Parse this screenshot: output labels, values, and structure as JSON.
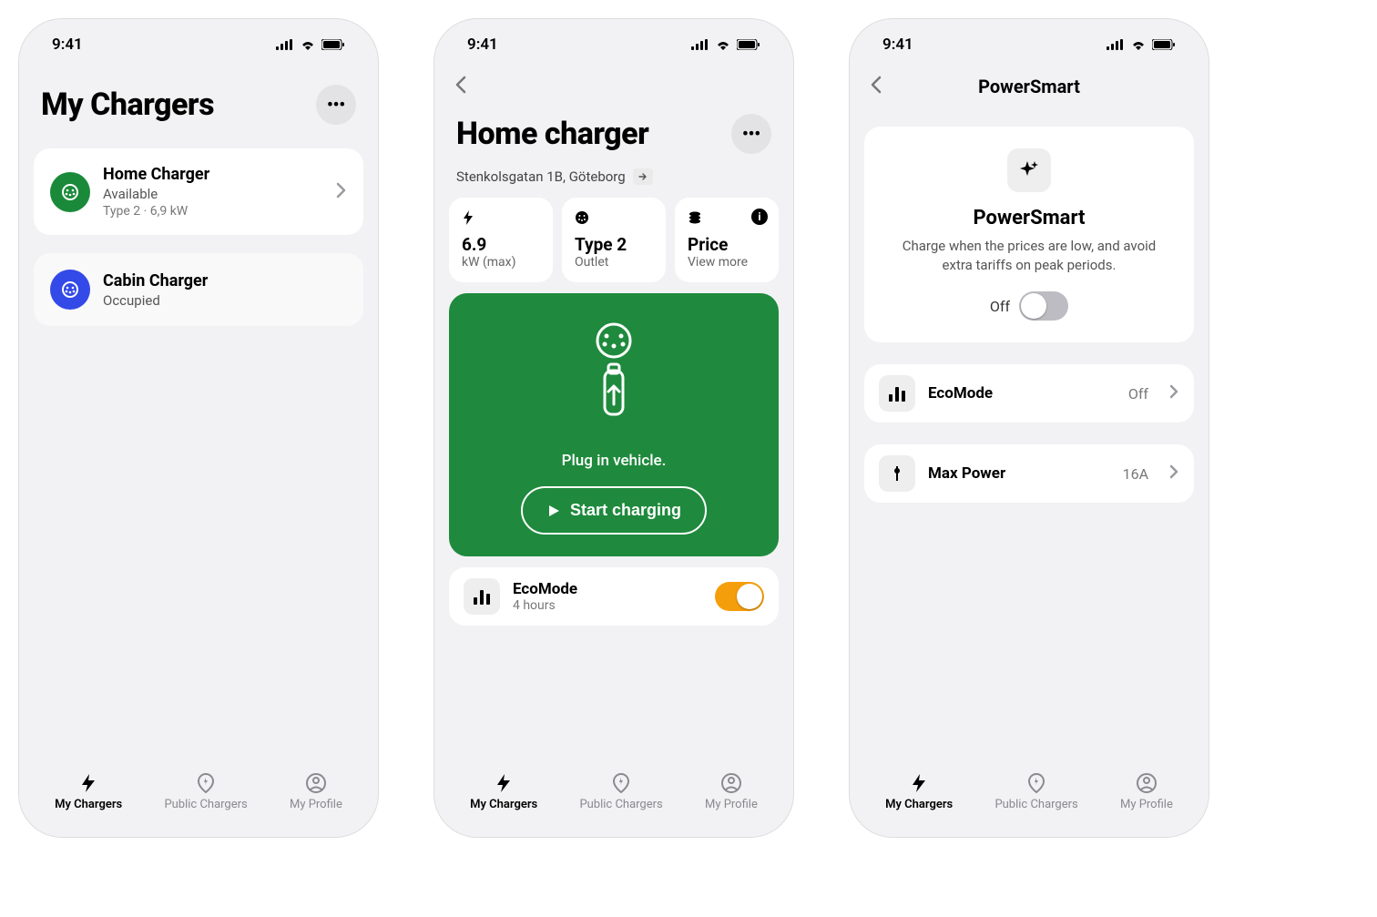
{
  "status": {
    "time": "9:41"
  },
  "tabs": {
    "my_chargers": "My Chargers",
    "public_chargers": "Public Chargers",
    "my_profile": "My Profile"
  },
  "screen1": {
    "title": "My Chargers",
    "chargers": [
      {
        "title": "Home Charger",
        "status": "Available",
        "connector": "Type 2",
        "power": "6,9 kW"
      },
      {
        "title": "Cabin Charger",
        "status": "Occupied"
      }
    ]
  },
  "screen2": {
    "title": "Home charger",
    "address": "Stenkolsgatan 1B, Göteborg",
    "stats": {
      "power_value": "6.9",
      "power_label": "kW (max)",
      "outlet_value": "Type 2",
      "outlet_label": "Outlet",
      "price_value": "Price",
      "price_label": "View more"
    },
    "charge_status": "Plug in vehicle.",
    "start_button": "Start charging",
    "eco": {
      "title": "EcoMode",
      "subtitle": "4 hours"
    }
  },
  "screen3": {
    "title": "PowerSmart",
    "hero": {
      "title": "PowerSmart",
      "desc": "Charge when the prices are low, and avoid extra tariffs on peak periods.",
      "state": "Off"
    },
    "items": [
      {
        "title": "EcoMode",
        "value": "Off"
      },
      {
        "title": "Max Power",
        "value": "16A"
      }
    ]
  }
}
